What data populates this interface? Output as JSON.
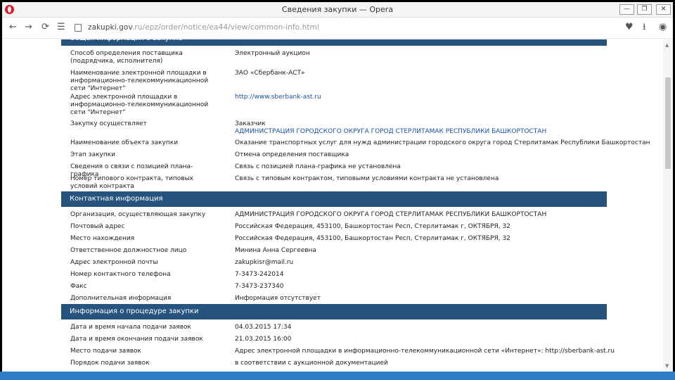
{
  "window": {
    "title": "Сведения закупки — Opera",
    "buttons": {
      "minimize": "—",
      "maximize": "❐",
      "close": "✕"
    }
  },
  "navbar": {
    "url_host": "zakupki.gov",
    "url_path": ".ru/epz/order/notice/ea44/view/common-info.html",
    "icons": [
      "back-icon",
      "forward-icon",
      "reload-icon",
      "speed-dial-icon",
      "heart-icon",
      "download-icon",
      "user-icon"
    ]
  },
  "sections": {
    "top": {
      "title": "Общая информация о закупке"
    },
    "contact": {
      "title": "Контактная информация"
    },
    "procedure": {
      "title": "Информация о процедуре закупки"
    }
  },
  "general": [
    {
      "label": "Способ определения поставщика (подрядчика, исполнителя)",
      "value": "Электронный аукцион"
    },
    {
      "label": "Наименование электронной площадки в информационно-телекоммуникационной сети \"Интернет\"",
      "value": "ЗАО «Сбербанк-АСТ»"
    },
    {
      "label": "Адрес электронной площадки в информационно-телекоммуникационной сети \"Интернет\"",
      "value": "http://www.sberbank-ast.ru"
    },
    {
      "label": "Закупку осуществляет",
      "value": "Заказчик",
      "value2": "АДМИНИСТРАЦИЯ ГОРОДСКОГО ОКРУГА ГОРОД СТЕРЛИТАМАК РЕСПУБЛИКИ БАШКОРТОСТАН"
    },
    {
      "label": "Наименование объекта закупки",
      "value": "Оказание транспортных услуг для нужд администрации городского округа город Стерлитамак Республики Башкортостан"
    },
    {
      "label": "Этап закупки",
      "value": "Отмена определения поставщика"
    },
    {
      "label": "Сведения о связи с позицией плана-графика",
      "value": "Связь с позицией плана-графика не установлена"
    },
    {
      "label": "Номер типового контракта, типовых условий контракта",
      "value": "Связь с типовым контрактом, типовыми условиями контракта не установлена"
    }
  ],
  "contact": [
    {
      "label": "Организация, осуществляющая закупку",
      "value": "АДМИНИСТРАЦИЯ ГОРОДСКОГО ОКРУГА ГОРОД СТЕРЛИТАМАК РЕСПУБЛИКИ БАШКОРТОСТАН"
    },
    {
      "label": "Почтовый адрес",
      "value": "Российская Федерация, 453100, Башкортостан Респ, Стерлитамак г, ОКТЯБРЯ, 32"
    },
    {
      "label": "Место нахождения",
      "value": "Российская Федерация, 453100, Башкортостан Респ, Стерлитамак г, ОКТЯБРЯ, 32"
    },
    {
      "label": "Ответственное должностное лицо",
      "value": "Минина Анна Сергеевна"
    },
    {
      "label": "Адрес электронной почты",
      "value": "zakupkisr@mail.ru"
    },
    {
      "label": "Номер контактного телефона",
      "value": "7-3473-242014"
    },
    {
      "label": "Факс",
      "value": "7-3473-237340"
    },
    {
      "label": "Дополнительная информация",
      "value": "Информация отсутствует"
    }
  ],
  "procedure": [
    {
      "label": "Дата и время начала подачи заявок",
      "value": "04.03.2015 17:34"
    },
    {
      "label": "Дата и время окончания подачи заявок",
      "value": "21.03.2015 16:00"
    },
    {
      "label": "Место подачи заявок",
      "value": "Адрес электронной площадки в информационно-телекоммуникационной сети «Интернет»: http://sberbank-ast.ru"
    },
    {
      "label": "Порядок подачи заявок",
      "value": "в соответствии с аукционной документацией"
    }
  ]
}
